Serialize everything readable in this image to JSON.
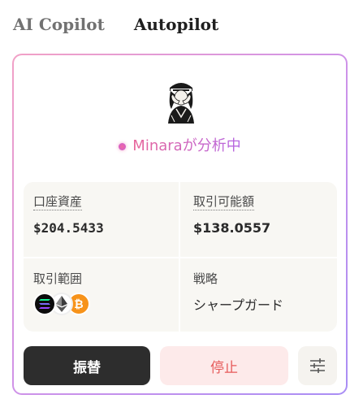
{
  "tabs": [
    {
      "label": "AI Copilot",
      "active": false
    },
    {
      "label": "Autopilot",
      "active": true
    }
  ],
  "status": {
    "text": "Minaraが分析中"
  },
  "stats": {
    "account_assets": {
      "label": "口座資産",
      "value": "$204.5433"
    },
    "tradable_amount": {
      "label": "取引可能額",
      "value": "$138.0557"
    },
    "trading_scope": {
      "label": "取引範囲",
      "coins": [
        "solana-icon",
        "ethereum-icon",
        "bitcoin-icon"
      ]
    },
    "strategy": {
      "label": "戦略",
      "value": "シャープガード"
    }
  },
  "buttons": {
    "transfer": "振替",
    "stop": "停止",
    "settings_icon": "sliders-icon"
  },
  "colors": {
    "border_gradient": [
      "#f2a1c6",
      "#cf92e8",
      "#a98ef5"
    ],
    "transfer_bg": "#2d2d2d",
    "stop_bg": "#fdeaea",
    "stop_text": "#e65a5a",
    "bitcoin": "#f7931a"
  }
}
